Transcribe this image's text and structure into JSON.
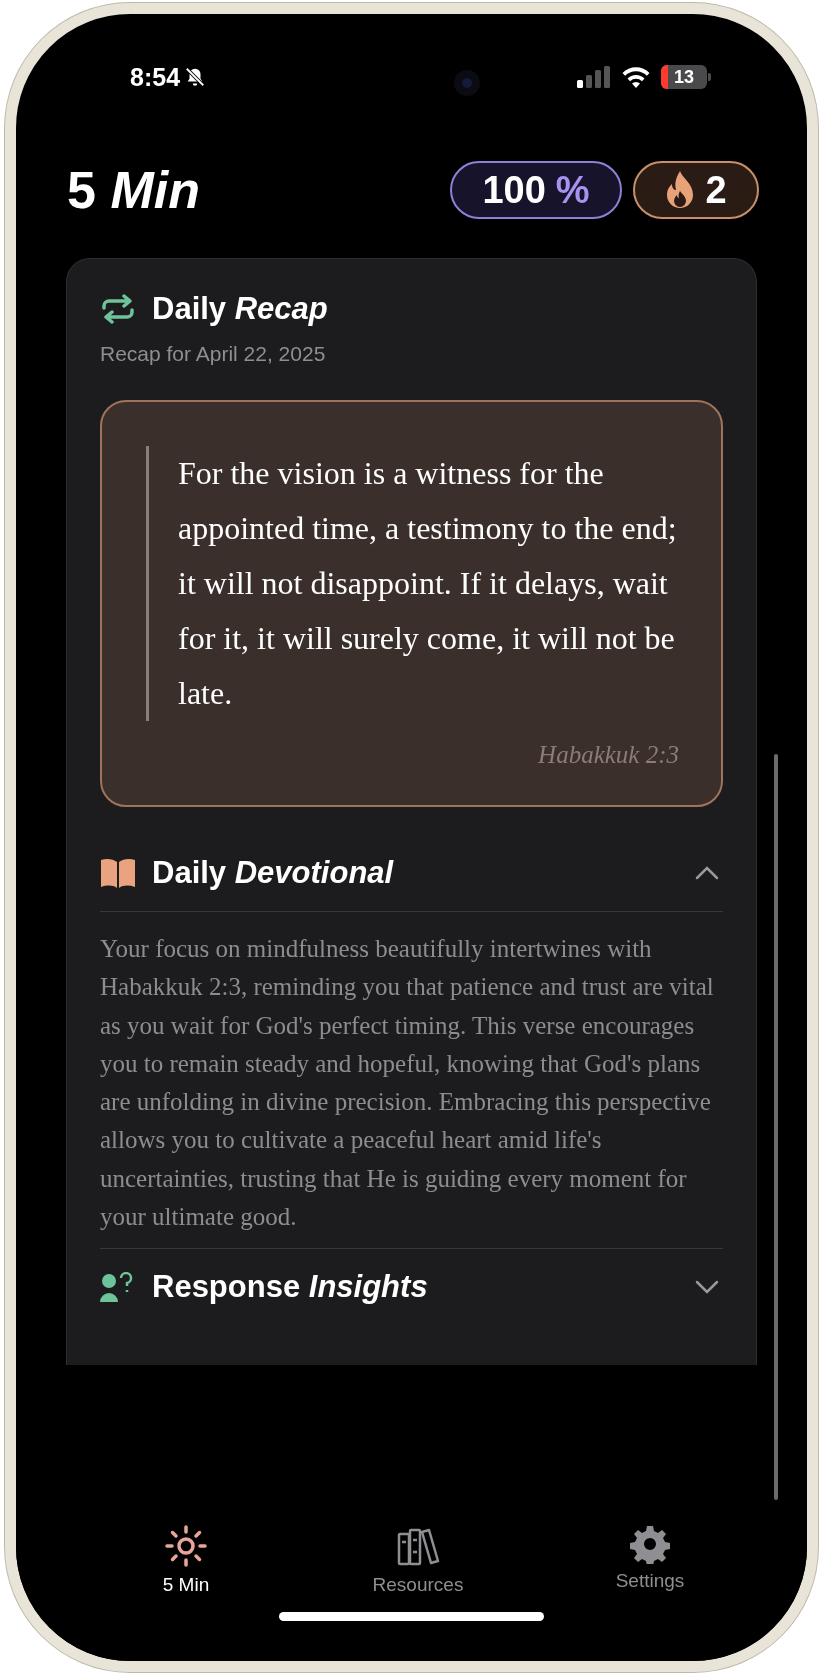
{
  "status_bar": {
    "time": "8:54",
    "battery": "13"
  },
  "header": {
    "title": "5 *Min*",
    "progress": {
      "value": "100",
      "unit": "%"
    },
    "streak": "2"
  },
  "recap": {
    "title": "Daily *Recap*",
    "subtitle": "Recap for April 22, 2025",
    "quote": "For the vision is a witness for the appointed time, a testimony to the end; it will not disappoint. If it delays, wait for it, it will surely come, it will not be late.",
    "reference": "Habakkuk 2:3"
  },
  "sections": [
    {
      "kind": "devotional",
      "title": "Daily *Devotional*",
      "expanded": true,
      "body": "Your focus on mindfulness beautifully intertwines with Habakkuk 2:3, reminding you that patience and trust are vital as you wait for God's perfect timing. This verse encourages you to remain steady and hopeful, knowing that God's plans are unfolding in divine precision. Embracing this perspective allows you to cultivate a peaceful heart amid life's uncertainties, trusting that He is guiding every moment for your ultimate good."
    },
    {
      "kind": "insights",
      "title": "Response *Insights*",
      "expanded": false
    }
  ],
  "tabs": [
    {
      "kind": "today",
      "label": "5 Min",
      "selected": true
    },
    {
      "kind": "resources",
      "label": "Resources",
      "selected": false
    },
    {
      "kind": "settings",
      "label": "Settings",
      "selected": false
    }
  ]
}
